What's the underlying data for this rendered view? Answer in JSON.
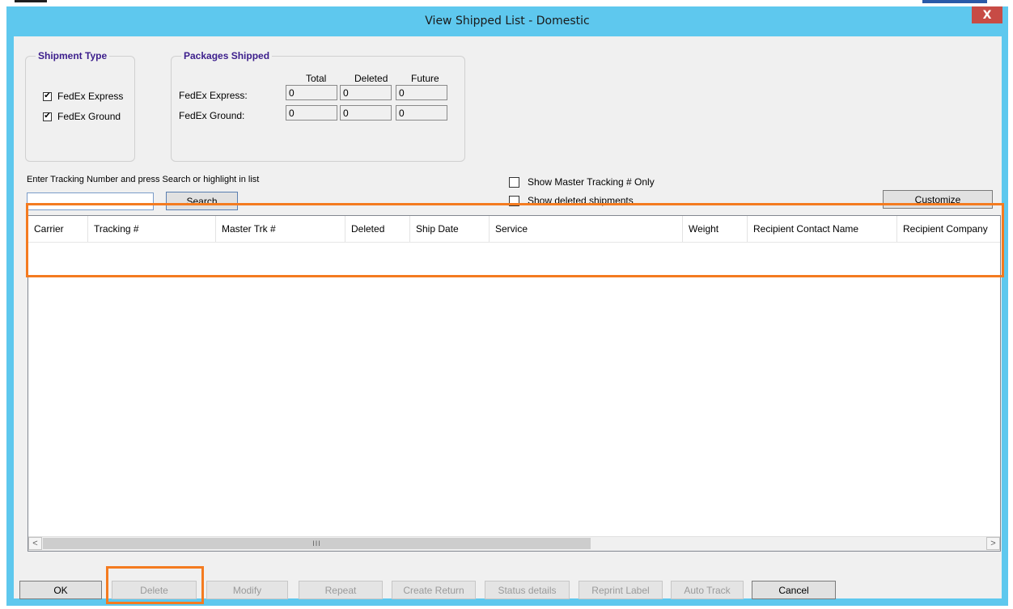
{
  "window": {
    "title": "View Shipped List - Domestic",
    "close_label": "X"
  },
  "shipment_type": {
    "legend": "Shipment Type",
    "options": [
      {
        "label": "FedEx Express",
        "checked": true
      },
      {
        "label": "FedEx Ground",
        "checked": true
      }
    ]
  },
  "packages_shipped": {
    "legend": "Packages Shipped",
    "columns": [
      "Total",
      "Deleted",
      "Future"
    ],
    "rows": [
      {
        "label": "FedEx Express:",
        "values": [
          "0",
          "0",
          "0"
        ]
      },
      {
        "label": "FedEx Ground:",
        "values": [
          "0",
          "0",
          "0"
        ]
      }
    ]
  },
  "search": {
    "instruction": "Enter Tracking Number and press Search or highlight in list",
    "value": "",
    "button_label": "Search"
  },
  "filters": {
    "master_only_label": "Show Master Tracking # Only",
    "master_only_checked": false,
    "deleted_label": "Show deleted shipments",
    "deleted_checked": false
  },
  "customize_label": "Customize",
  "list": {
    "columns": [
      "Carrier",
      "Tracking #",
      "Master Trk #",
      "Deleted",
      "Ship Date",
      "Service",
      "Weight",
      "Recipient Contact Name",
      "Recipient Company"
    ],
    "rows": [],
    "scroll_left": "<",
    "scroll_right": ">",
    "scroll_grip": "III"
  },
  "buttons": {
    "ok": "OK",
    "delete": "Delete",
    "modify": "Modify",
    "repeat": "Repeat",
    "create_return": "Create Return",
    "status_details": "Status details",
    "reprint_label": "Reprint Label",
    "auto_track": "Auto Track",
    "cancel": "Cancel"
  },
  "colors": {
    "title_bar": "#5ec8ee",
    "close_button": "#c74b45",
    "highlight": "#f47b20",
    "group_legend": "#3c1e8c"
  }
}
